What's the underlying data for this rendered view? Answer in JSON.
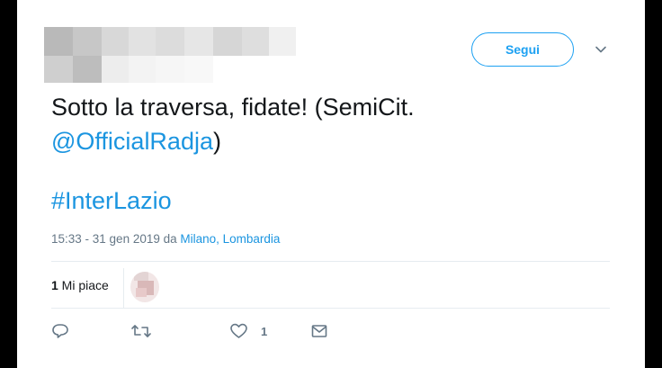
{
  "header": {
    "follow_label": "Segui"
  },
  "tweet": {
    "text_line1": "Sotto la traversa, fidate! (SemiCit.",
    "mention": "@OfficialRadja",
    "mention_close": ")",
    "hashtag": "#InterLazio",
    "timestamp": "15:33 - 31 gen 2019 da ",
    "location": "Milano, Lombardia"
  },
  "likes": {
    "count": "1",
    "label": " Mi piace"
  },
  "actions": {
    "reply_icon": "reply-icon",
    "retweet_icon": "retweet-icon",
    "like_icon": "heart-icon",
    "like_count": "1",
    "dm_icon": "envelope-icon"
  },
  "colors": {
    "accent": "#1da1f2",
    "link": "#1b95e0",
    "text": "#14171a",
    "muted": "#657786",
    "divider": "#e6ecf0"
  }
}
